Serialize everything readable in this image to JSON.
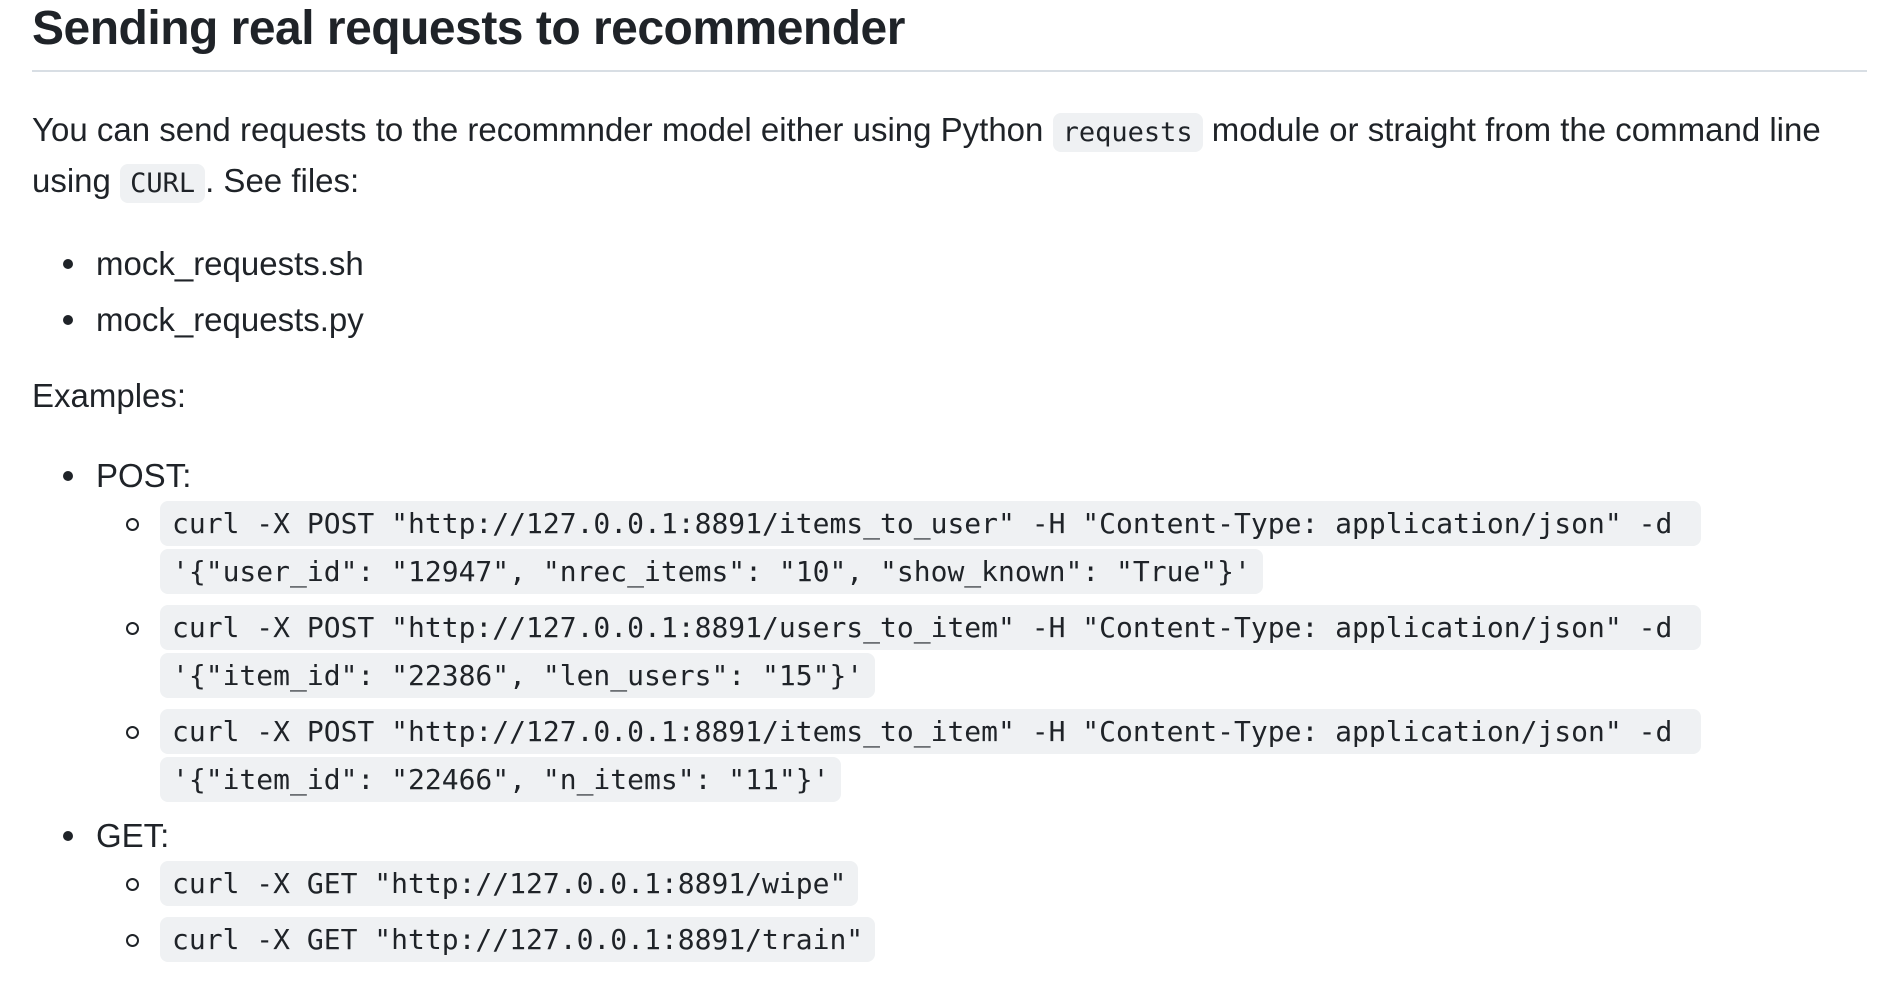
{
  "heading": "Sending real requests to recommender",
  "intro": {
    "text_before": "You can send requests to the recommnder model either using Python ",
    "code_requests": "requests",
    "text_middle": " module or straight from the command line using ",
    "code_curl": "CURL",
    "text_after": ". See files:"
  },
  "files": [
    "mock_requests.sh",
    "mock_requests.py"
  ],
  "examples_label": "Examples:",
  "post": {
    "label": "POST:",
    "commands": [
      "curl -X POST \"http://127.0.0.1:8891/items_to_user\" -H \"Content-Type: application/json\" -d '{\"user_id\": \"12947\", \"nrec_items\": \"10\", \"show_known\": \"True\"}'",
      "curl -X POST \"http://127.0.0.1:8891/users_to_item\" -H \"Content-Type: application/json\" -d '{\"item_id\": \"22386\", \"len_users\": \"15\"}'",
      "curl -X POST \"http://127.0.0.1:8891/items_to_item\" -H \"Content-Type: application/json\" -d '{\"item_id\": \"22466\", \"n_items\": \"11\"}'"
    ]
  },
  "get": {
    "label": "GET:",
    "commands": [
      "curl -X GET \"http://127.0.0.1:8891/wipe\"",
      "curl -X GET \"http://127.0.0.1:8891/train\""
    ]
  }
}
